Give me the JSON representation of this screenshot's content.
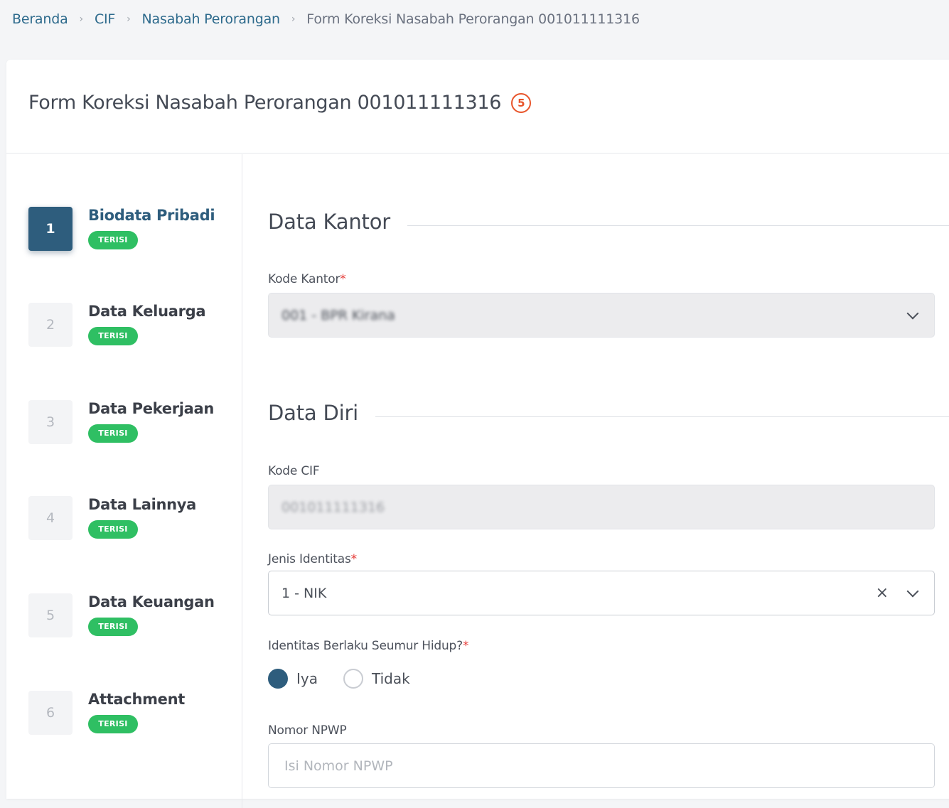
{
  "breadcrumb": {
    "items": [
      "Beranda",
      "CIF",
      "Nasabah Perorangan"
    ],
    "current": "Form Koreksi Nasabah Perorangan 001011111316"
  },
  "page": {
    "title": "Form Koreksi Nasabah Perorangan 001011111316",
    "annotation": "5"
  },
  "steps": [
    {
      "num": "1",
      "label": "Biodata Pribadi",
      "badge": "TERISI"
    },
    {
      "num": "2",
      "label": "Data Keluarga",
      "badge": "TERISI"
    },
    {
      "num": "3",
      "label": "Data Pekerjaan",
      "badge": "TERISI"
    },
    {
      "num": "4",
      "label": "Data Lainnya",
      "badge": "TERISI"
    },
    {
      "num": "5",
      "label": "Data Keuangan",
      "badge": "TERISI"
    },
    {
      "num": "6",
      "label": "Attachment",
      "badge": "TERISI"
    }
  ],
  "sections": {
    "kantor": "Data Kantor",
    "diri": "Data Diri"
  },
  "fields": {
    "kode_kantor": {
      "label": "Kode Kantor",
      "required": "*",
      "value": "001 - BPR Kirana"
    },
    "kode_cif": {
      "label": "Kode CIF",
      "value": "001011111316"
    },
    "jenis_identitas": {
      "label": "Jenis Identitas",
      "required": "*",
      "value": "1 - NIK",
      "clear": "×"
    },
    "berlaku": {
      "label": "Identitas Berlaku Seumur Hidup?",
      "required": "*",
      "option_yes": "Iya",
      "option_no": "Tidak"
    },
    "npwp": {
      "label": "Nomor NPWP",
      "placeholder": "Isi Nomor NPWP"
    }
  }
}
